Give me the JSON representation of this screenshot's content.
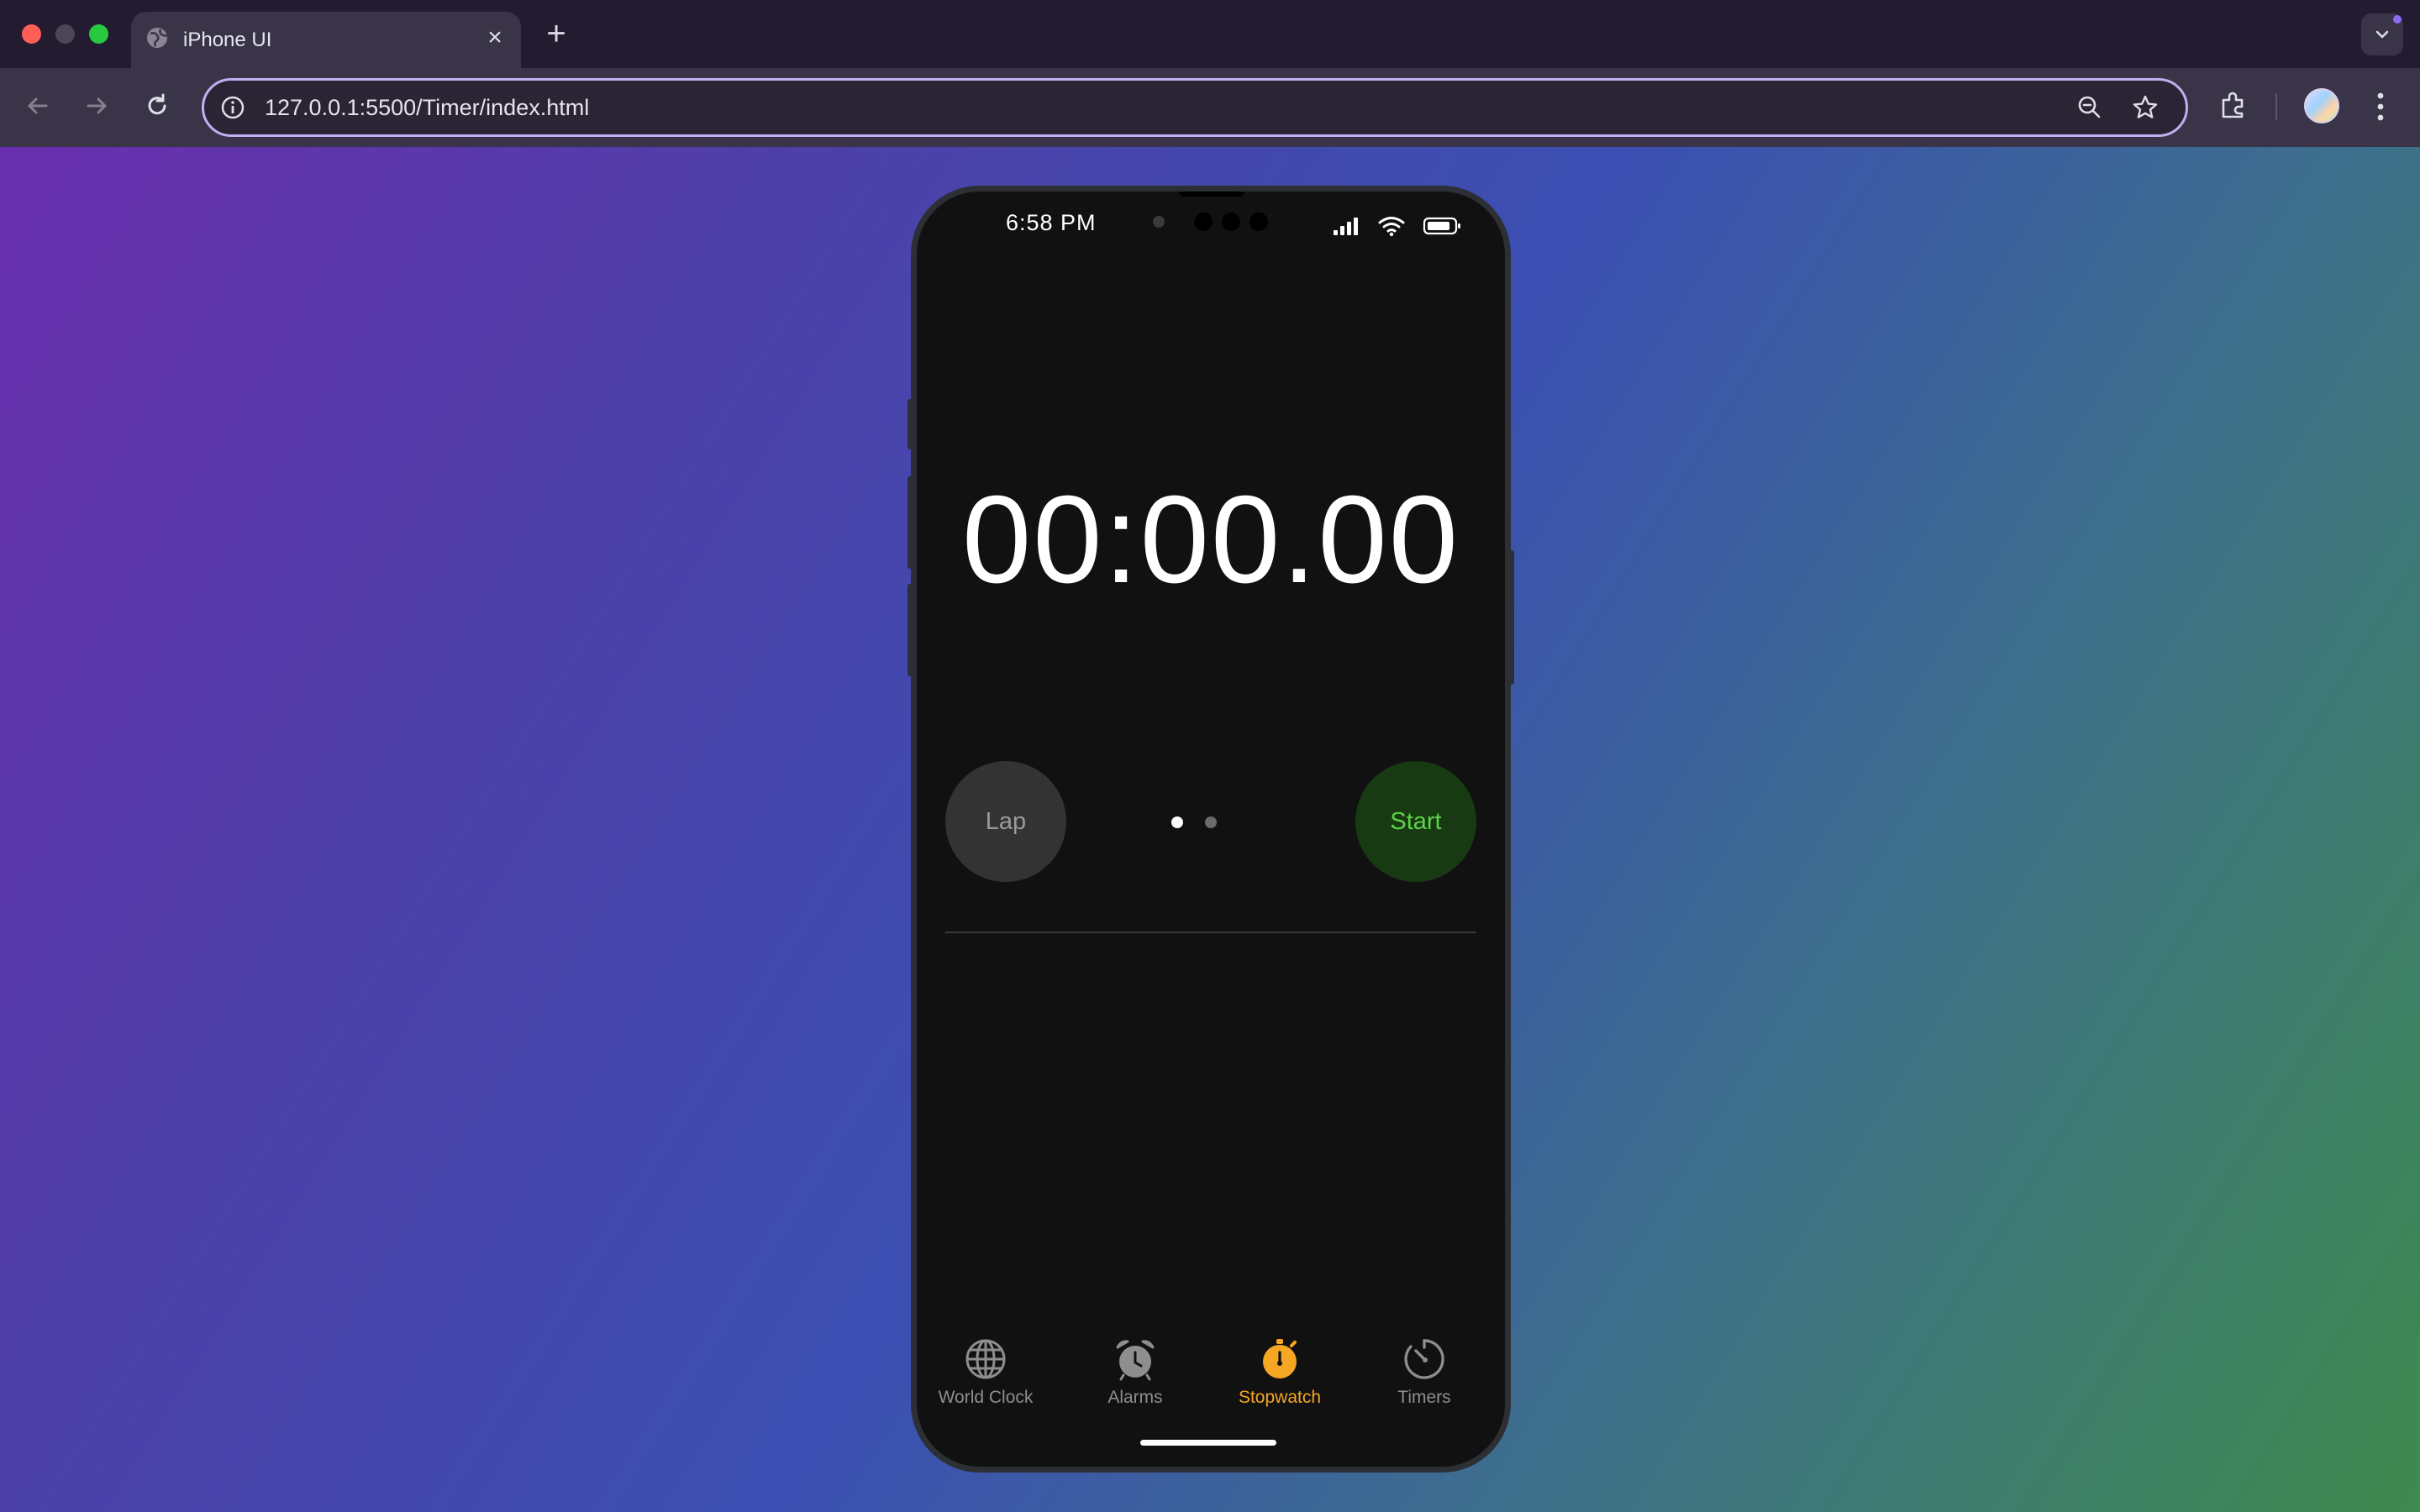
{
  "browser": {
    "tab_title": "iPhone UI",
    "new_tab_symbol": "+",
    "close_symbol": "×",
    "url": "127.0.0.1:5500/Timer/index.html",
    "icons": [
      "globe-icon",
      "back-icon",
      "forward-icon",
      "reload-icon",
      "info-icon",
      "zoom-out-icon",
      "star-icon",
      "extensions-icon",
      "profile-avatar",
      "kebab-menu-icon",
      "tab-search-icon"
    ]
  },
  "phone": {
    "status_bar": {
      "time": "6:58 PM",
      "icons": [
        "cellular-signal-icon",
        "wifi-icon",
        "battery-icon"
      ]
    },
    "stopwatch": {
      "display": "00:00.00",
      "lap_label": "Lap",
      "start_label": "Start",
      "page_indicator": {
        "count": 2,
        "active": 0
      }
    },
    "tab_bar": {
      "items": [
        {
          "label": "World Clock",
          "icon": "globe-icon",
          "active": false
        },
        {
          "label": "Alarms",
          "icon": "alarm-clock-icon",
          "active": false
        },
        {
          "label": "Stopwatch",
          "icon": "stopwatch-icon",
          "active": true
        },
        {
          "label": "Timers",
          "icon": "timer-icon",
          "active": false
        }
      ]
    }
  },
  "colors": {
    "accent_active_tab": "#f5a623",
    "start_button_bg": "#173a12",
    "start_button_text": "#5ed14a",
    "lap_button_bg": "#333333",
    "lap_button_text": "#9a9a9a",
    "phone_screen_bg": "#111111"
  }
}
